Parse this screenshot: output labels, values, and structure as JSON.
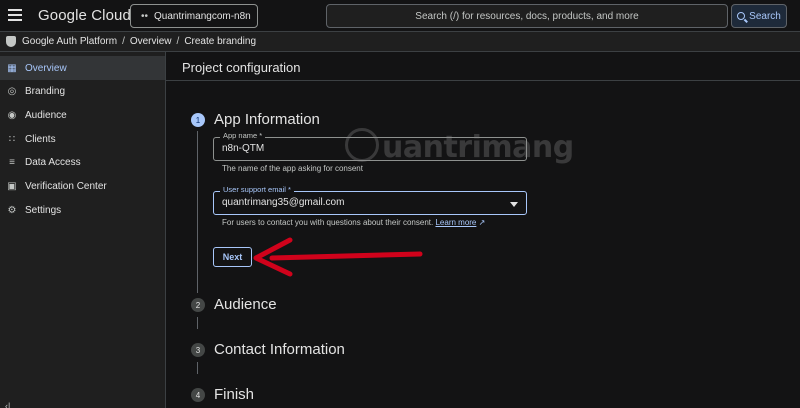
{
  "topbar": {
    "logo": "Google Cloud",
    "project": "Quantrimangcom-n8n",
    "search_placeholder": "Search (/) for resources, docs, products, and more",
    "search_button": "Search"
  },
  "breadcrumb": {
    "items": [
      "Google Auth Platform",
      "Overview",
      "Create branding"
    ]
  },
  "sidebar": {
    "items": [
      {
        "label": "Overview",
        "icon": "dashboard-icon"
      },
      {
        "label": "Branding",
        "icon": "palette-icon"
      },
      {
        "label": "Audience",
        "icon": "person-icon"
      },
      {
        "label": "Clients",
        "icon": "grid-icon"
      },
      {
        "label": "Data Access",
        "icon": "list-icon"
      },
      {
        "label": "Verification Center",
        "icon": "verified-icon"
      },
      {
        "label": "Settings",
        "icon": "gear-icon"
      }
    ],
    "collapse_label": "‹|"
  },
  "main": {
    "title": "Project configuration",
    "steps": [
      {
        "number": "1",
        "label": "App Information"
      },
      {
        "number": "2",
        "label": "Audience"
      },
      {
        "number": "3",
        "label": "Contact Information"
      },
      {
        "number": "4",
        "label": "Finish"
      }
    ],
    "app_name": {
      "label": "App name *",
      "value": "n8n-QTM",
      "helper": "The name of the app asking for consent"
    },
    "support_email": {
      "label": "User support email *",
      "value": "quantrimang35@gmail.com",
      "helper": "For users to contact you with questions about their consent.",
      "learn_more": "Learn more"
    },
    "next_button": "Next"
  },
  "watermark": {
    "text": "uantrimang"
  },
  "colors": {
    "accent": "#a8c7fa",
    "arrow": "#d0021b"
  }
}
